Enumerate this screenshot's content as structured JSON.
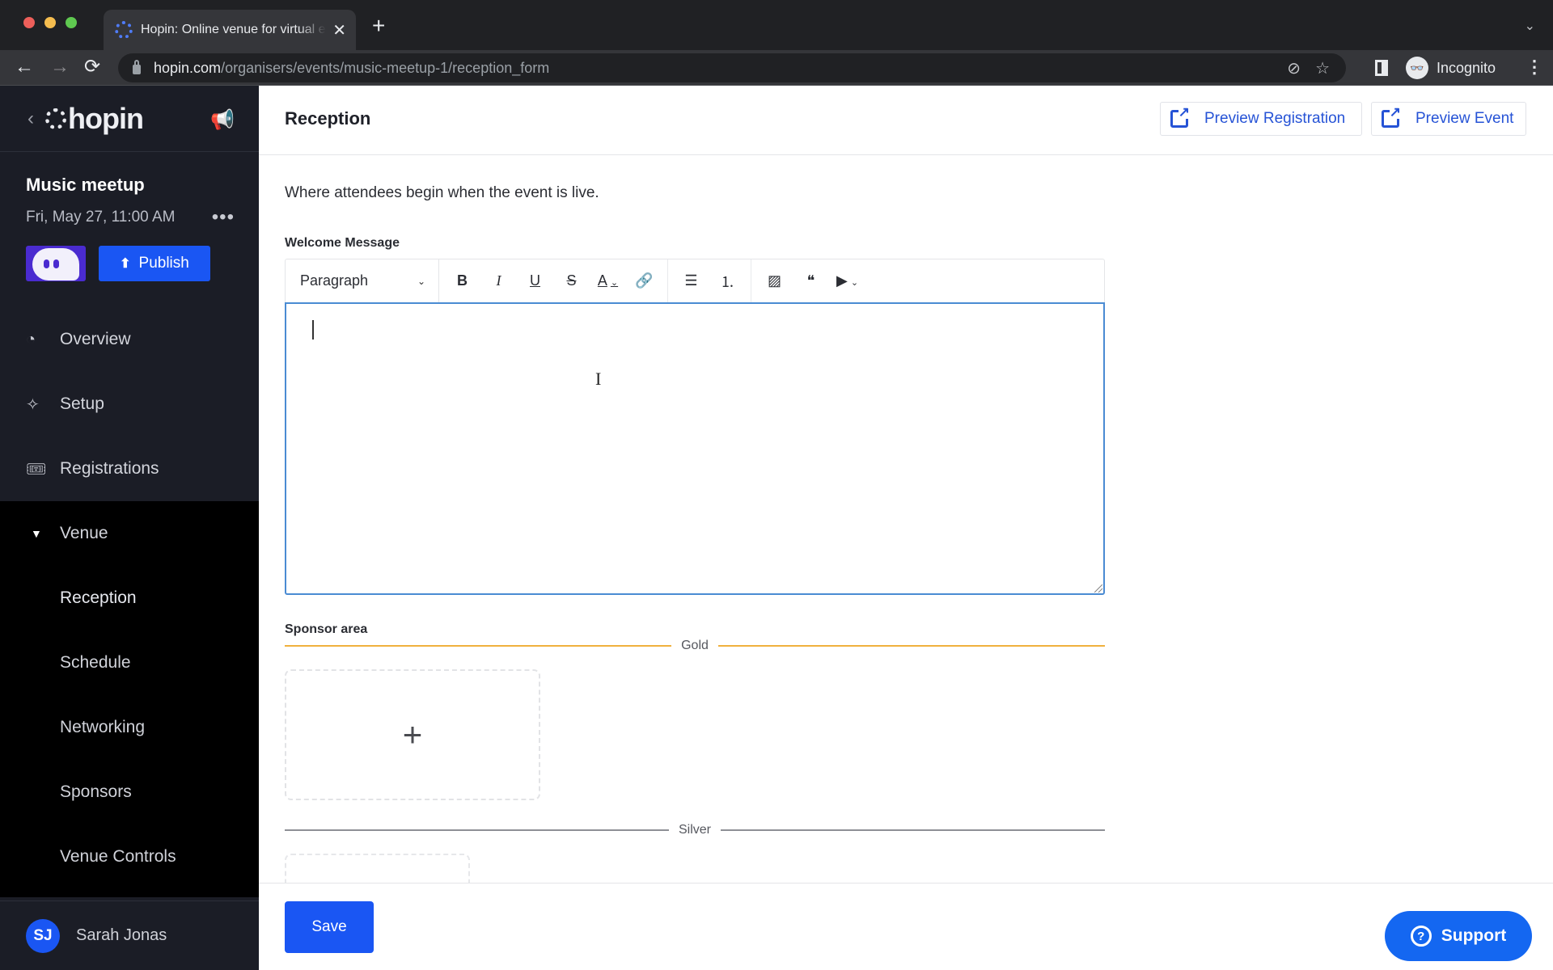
{
  "browser": {
    "tab_title": "Hopin: Online venue for virtual events",
    "url_host": "hopin.com",
    "url_path": "/organisers/events/music-meetup-1/reception_form",
    "profile_label": "Incognito",
    "icons": {
      "back": "←",
      "forward": "→",
      "reload": "⟳",
      "new_tab": "+",
      "close_tab": "✕",
      "tabs_menu": "⌄",
      "eye_off": "⊘",
      "star": "☆",
      "menu": "⋮",
      "incognito": "👓"
    }
  },
  "sidebar": {
    "back_icon": "‹",
    "logo_text": "hopin",
    "megaphone_icon": "📢",
    "event_name": "Music meetup",
    "event_date": "Fri, May 27, 11:00 AM",
    "more_icon": "•••",
    "publish_label": "Publish",
    "publish_icon": "⬆",
    "nav": [
      {
        "label": "Overview",
        "icon": "◔"
      },
      {
        "label": "Setup",
        "icon": "✧"
      },
      {
        "label": "Registrations",
        "icon": "🎟"
      }
    ],
    "venue": {
      "label": "Venue",
      "caret_icon": "▼",
      "items": [
        {
          "label": "Reception"
        },
        {
          "label": "Schedule"
        },
        {
          "label": "Networking"
        },
        {
          "label": "Sponsors"
        },
        {
          "label": "Venue Controls"
        }
      ]
    },
    "user": {
      "initials": "SJ",
      "name": "Sarah Jonas"
    }
  },
  "main": {
    "title": "Reception",
    "preview_registration_label": "Preview Registration",
    "preview_event_label": "Preview Event",
    "description": "Where attendees begin when the event is live.",
    "welcome_label": "Welcome Message",
    "editor": {
      "block_format": "Paragraph",
      "chevron": "⌄",
      "tools": {
        "bold": "B",
        "italic": "I",
        "underline": "U",
        "strike": "S",
        "color": "A",
        "link": "🔗",
        "bullet_list": "☰",
        "numbered_list": "⒈",
        "image": "▨",
        "quote": "❝",
        "media": "▶"
      },
      "value": "",
      "ibeam": "I"
    },
    "sponsor_label": "Sponsor area",
    "tiers": [
      {
        "name": "Gold",
        "color": "#f0b13e"
      },
      {
        "name": "Silver",
        "color": "#8e9096"
      }
    ],
    "add_icon": "+",
    "save_label": "Save",
    "support_label": "Support",
    "support_icon": "?"
  },
  "colors": {
    "brand_blue": "#1a56f3",
    "sidebar_bg": "#1b1d26",
    "link_blue": "#2653d6",
    "editor_focus": "#4a8bd3"
  }
}
